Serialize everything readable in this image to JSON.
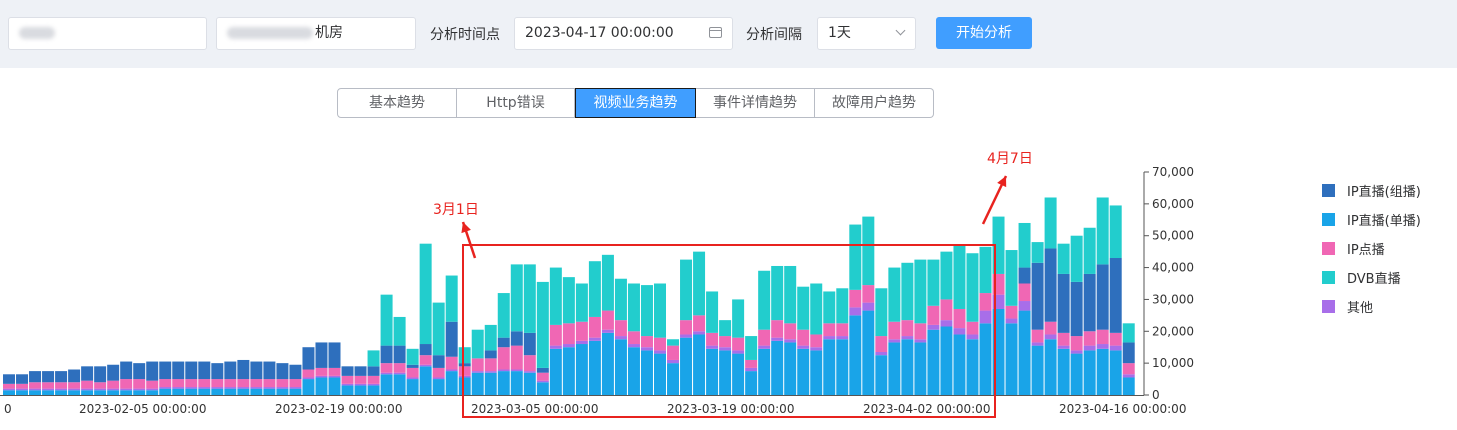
{
  "toolbar": {
    "field1_label": "",
    "field2_suffix": "机房",
    "time_label": "分析时间点",
    "time_value": "2023-04-17 00:00:00",
    "interval_label": "分析间隔",
    "interval_value": "1天",
    "start_label": "开始分析"
  },
  "tabs": [
    {
      "label": "基本趋势",
      "active": false
    },
    {
      "label": "Http错误",
      "active": false
    },
    {
      "label": "视频业务趋势",
      "active": true
    },
    {
      "label": "事件详情趋势",
      "active": false
    },
    {
      "label": "故障用户趋势",
      "active": false
    }
  ],
  "annotations": {
    "march": "3月1日",
    "april": "4月7日"
  },
  "chart_data": {
    "type": "bar",
    "stacked": true,
    "x_tick_labels": [
      "0",
      "2023-02-05 00:00:00",
      "2023-02-19 00:00:00",
      "2023-03-05 00:00:00",
      "2023-03-19 00:00:00",
      "2023-04-02 00:00:00",
      "2023-04-16 00:00:00"
    ],
    "y_tick_labels": [
      "0",
      "10,000",
      "20,000",
      "30,000",
      "40,000",
      "50,000",
      "60,000",
      "70,000"
    ],
    "ylim": [
      0,
      70000
    ],
    "y_axis_side": "right",
    "legend_position": "right",
    "series": [
      {
        "name": "IP直播(组播)",
        "color": "#2e6fbd"
      },
      {
        "name": "IP直播(单播)",
        "color": "#19a4e8"
      },
      {
        "name": "IP点播",
        "color": "#f067b4"
      },
      {
        "name": "DVB直播",
        "color": "#22cdcd"
      },
      {
        "name": "其他",
        "color": "#a86ee9"
      }
    ],
    "stack_order_bottom_to_top": [
      "IP直播(单播)",
      "其他",
      "IP点播",
      "IP直播(组播)",
      "DVB直播"
    ],
    "values": {
      "单播": [
        1500,
        1500,
        1500,
        1500,
        1500,
        1500,
        1500,
        1500,
        1500,
        1500,
        1500,
        1500,
        2000,
        2000,
        2000,
        2000,
        2000,
        2000,
        2000,
        2000,
        2000,
        2000,
        2000,
        5000,
        5500,
        5500,
        3000,
        3000,
        3000,
        6500,
        6500,
        5000,
        9000,
        5000,
        7500,
        5500,
        7000,
        7000,
        7500,
        7500,
        7000,
        4000,
        14500,
        15000,
        16000,
        17000,
        19500,
        17500,
        15000,
        14000,
        13000,
        10000,
        18000,
        19000,
        14500,
        14000,
        13000,
        7500,
        14500,
        17000,
        16500,
        14500,
        14000,
        17500,
        17500,
        25000,
        26500,
        12500,
        16500,
        17500,
        16500,
        20500,
        21500,
        19000,
        17500,
        22500,
        27000,
        22500,
        26500,
        15500,
        17500,
        14500,
        13000,
        14000,
        14500,
        14000,
        5500
      ],
      "其他": [
        500,
        500,
        500,
        500,
        500,
        500,
        500,
        500,
        500,
        500,
        500,
        500,
        500,
        500,
        500,
        500,
        500,
        500,
        500,
        500,
        500,
        500,
        500,
        500,
        500,
        500,
        500,
        500,
        500,
        500,
        500,
        500,
        500,
        500,
        500,
        500,
        500,
        500,
        500,
        500,
        500,
        500,
        1000,
        1000,
        1000,
        1000,
        1000,
        1000,
        1000,
        1000,
        1000,
        1000,
        1000,
        1000,
        1000,
        1000,
        1000,
        1000,
        1000,
        1000,
        1000,
        1000,
        1000,
        1000,
        1000,
        2500,
        2500,
        1000,
        1000,
        1000,
        1000,
        1500,
        2000,
        2000,
        1500,
        4000,
        4500,
        1500,
        3000,
        1000,
        1500,
        1000,
        1000,
        1500,
        1500,
        1500,
        1000
      ],
      "点播": [
        1500,
        1500,
        2000,
        2000,
        2000,
        2000,
        2500,
        2000,
        2500,
        3000,
        3000,
        2500,
        2500,
        2500,
        2500,
        2500,
        2500,
        2500,
        2500,
        2500,
        2500,
        2500,
        2500,
        2500,
        2500,
        2500,
        2500,
        2500,
        2500,
        3000,
        3000,
        3000,
        3000,
        3000,
        4000,
        3000,
        4000,
        4000,
        7000,
        7500,
        5000,
        2500,
        6500,
        6500,
        6000,
        6500,
        6000,
        5000,
        4000,
        3500,
        4000,
        4500,
        4500,
        5000,
        4000,
        3500,
        4000,
        2500,
        5000,
        5500,
        5000,
        5000,
        4000,
        4000,
        4000,
        5500,
        5500,
        5000,
        5500,
        5000,
        5000,
        6000,
        6500,
        6000,
        4000,
        5500,
        6500,
        4000,
        5500,
        4000,
        4000,
        4000,
        4500,
        4500,
        4500,
        4000,
        3500
      ],
      "组播": [
        3000,
        3000,
        3500,
        3500,
        3500,
        4000,
        4500,
        5000,
        5000,
        5500,
        5000,
        6000,
        5500,
        5500,
        5500,
        5500,
        5000,
        5500,
        6000,
        5500,
        5500,
        5000,
        4500,
        7000,
        8000,
        8000,
        3000,
        3000,
        3000,
        5500,
        5500,
        1000,
        3500,
        4000,
        11000,
        1000,
        0,
        2500,
        3000,
        4500,
        7000,
        1500,
        0,
        0,
        0,
        0,
        0,
        0,
        0,
        0,
        0,
        0,
        0,
        0,
        0,
        0,
        0,
        0,
        0,
        0,
        0,
        0,
        0,
        0,
        0,
        0,
        0,
        0,
        0,
        0,
        0,
        0,
        0,
        0,
        0,
        0,
        0,
        0,
        5000,
        21000,
        23000,
        18500,
        17000,
        18000,
        20500,
        23500,
        6500
      ],
      "DVB直播": [
        0,
        0,
        0,
        0,
        0,
        0,
        0,
        0,
        0,
        0,
        0,
        0,
        0,
        0,
        0,
        0,
        0,
        0,
        0,
        0,
        0,
        0,
        0,
        0,
        0,
        0,
        0,
        0,
        5000,
        16000,
        9000,
        5000,
        31500,
        16500,
        14500,
        5000,
        9000,
        8000,
        14000,
        21000,
        21500,
        27000,
        18000,
        14500,
        12000,
        17500,
        17500,
        13000,
        15000,
        16000,
        17000,
        2000,
        19000,
        20000,
        13000,
        5000,
        12000,
        7500,
        18500,
        17000,
        18000,
        13500,
        16000,
        10000,
        11000,
        20500,
        21500,
        15000,
        17000,
        18000,
        20000,
        14500,
        15000,
        20000,
        21500,
        14500,
        18000,
        17500,
        14000,
        6500,
        16000,
        9500,
        14500,
        14500,
        21000,
        16500,
        6000
      ]
    }
  }
}
